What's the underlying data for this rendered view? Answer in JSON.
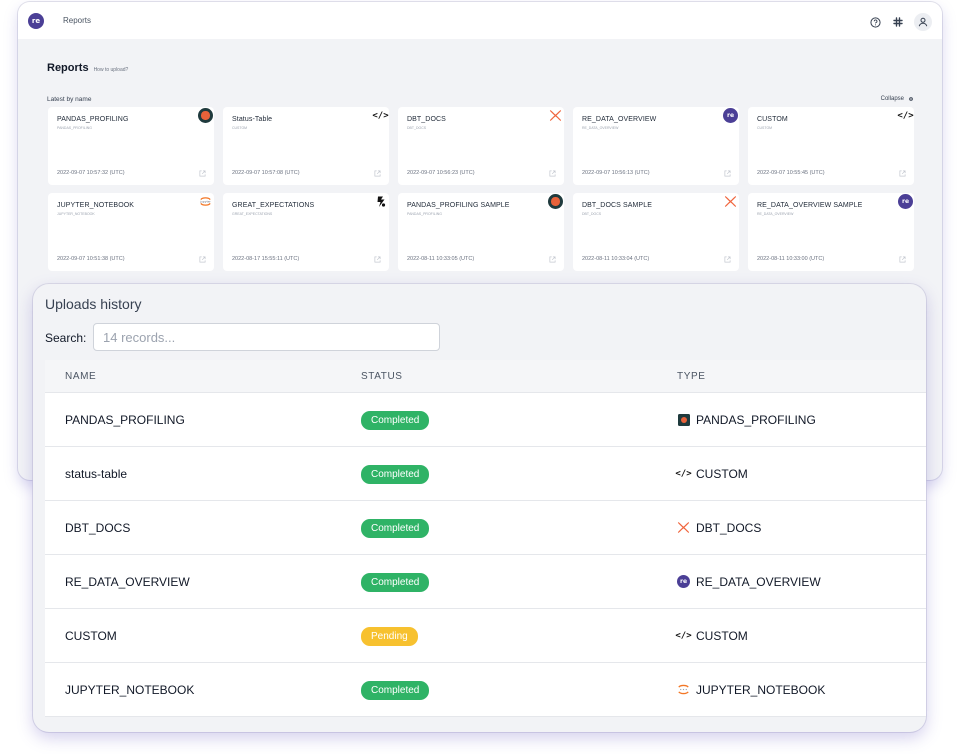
{
  "header": {
    "logo_text": "re",
    "breadcrumb": "Reports",
    "icons": [
      "help-icon",
      "slack-icon",
      "user-icon"
    ]
  },
  "reports": {
    "title": "Reports",
    "upload_help": "How to upload?",
    "section_label": "Latest by name",
    "collapse_label": "Collapse",
    "cards": [
      {
        "title": "PANDAS_PROFILING",
        "subtitle": "PANDAS_PROFILING",
        "date": "2022-09-07 10:57:32 (UTC)",
        "icon": "pandas-icon"
      },
      {
        "title": "Status-Table",
        "subtitle": "CUSTOM",
        "date": "2022-09-07 10:57:08 (UTC)",
        "icon": "code-icon"
      },
      {
        "title": "DBT_DOCS",
        "subtitle": "DBT_DOCS",
        "date": "2022-09-07 10:56:23 (UTC)",
        "icon": "dbt-icon"
      },
      {
        "title": "RE_DATA_OVERVIEW",
        "subtitle": "RE_DATA_OVERVIEW",
        "date": "2022-09-07 10:56:13 (UTC)",
        "icon": "re-data-icon"
      },
      {
        "title": "CUSTOM",
        "subtitle": "CUSTOM",
        "date": "2022-09-07 10:55:45 (UTC)",
        "icon": "code-icon"
      },
      {
        "title": "JUPYTER_NOTEBOOK",
        "subtitle": "JUPYTER_NOTEBOOK",
        "date": "2022-09-07 10:51:38 (UTC)",
        "icon": "jupyter-icon"
      },
      {
        "title": "GREAT_EXPECTATIONS",
        "subtitle": "GREAT_EXPECTATIONS",
        "date": "2022-08-17 15:55:11 (UTC)",
        "icon": "great-expectations-icon"
      },
      {
        "title": "PANDAS_PROFILING SAMPLE",
        "subtitle": "PANDAS_PROFILING",
        "date": "2022-08-11 10:33:05 (UTC)",
        "icon": "pandas-icon"
      },
      {
        "title": "DBT_DOCS SAMPLE",
        "subtitle": "DBT_DOCS",
        "date": "2022-08-11 10:33:04 (UTC)",
        "icon": "dbt-icon"
      },
      {
        "title": "RE_DATA_OVERVIEW SAMPLE",
        "subtitle": "RE_DATA_OVERVIEW",
        "date": "2022-08-11 10:33:00 (UTC)",
        "icon": "re-data-icon"
      }
    ]
  },
  "uploads": {
    "title": "Uploads history",
    "search_label": "Search:",
    "search_placeholder": "14 records...",
    "columns": [
      "NAME",
      "STATUS",
      "TYPE"
    ],
    "rows": [
      {
        "name": "PANDAS_PROFILING",
        "status": "Completed",
        "type": "PANDAS_PROFILING",
        "type_icon": "pandas-icon"
      },
      {
        "name": "status-table",
        "status": "Completed",
        "type": "CUSTOM",
        "type_icon": "code-icon"
      },
      {
        "name": "DBT_DOCS",
        "status": "Completed",
        "type": "DBT_DOCS",
        "type_icon": "dbt-icon"
      },
      {
        "name": "RE_DATA_OVERVIEW",
        "status": "Completed",
        "type": "RE_DATA_OVERVIEW",
        "type_icon": "re-data-icon"
      },
      {
        "name": "CUSTOM",
        "status": "Pending",
        "type": "CUSTOM",
        "type_icon": "code-icon"
      },
      {
        "name": "JUPYTER_NOTEBOOK",
        "status": "Completed",
        "type": "JUPYTER_NOTEBOOK",
        "type_icon": "jupyter-icon"
      }
    ]
  },
  "colors": {
    "brand": "#4b3f96",
    "completed": "#2fb366",
    "pending": "#f7c12f",
    "dbt": "#f0643c"
  }
}
